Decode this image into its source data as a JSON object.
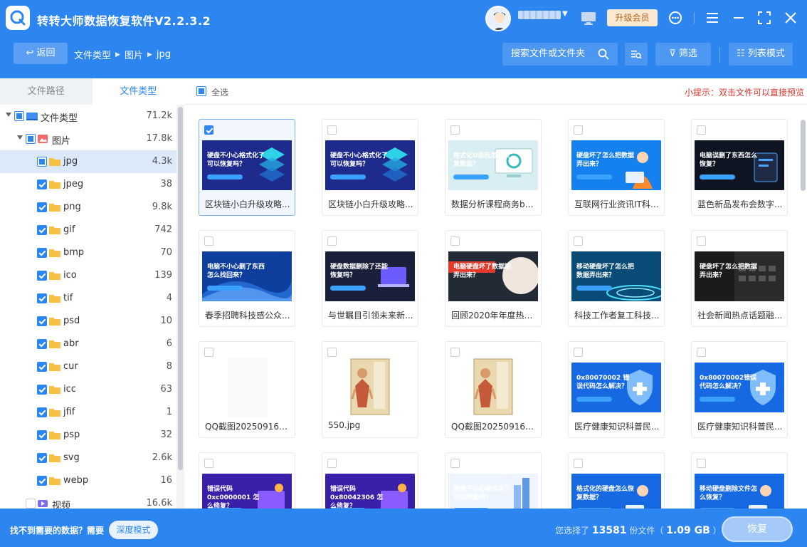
{
  "app": {
    "title": "转转大师数据恢复软件V2.2.3.2",
    "upgrade_label": "升级会员"
  },
  "toolbar": {
    "back_label": "返回",
    "breadcrumbs": [
      "文件类型",
      "图片",
      "jpg"
    ],
    "search_placeholder": "搜索文件或文件夹",
    "filter_label": "筛选",
    "view_label": "列表模式"
  },
  "left_tabs": [
    "文件路径",
    "文件类型"
  ],
  "tree": [
    {
      "label": "文件类型",
      "count": "71.2k",
      "state": "partial",
      "level": 0,
      "arrow": "down"
    },
    {
      "label": "图片",
      "count": "17.8k",
      "state": "partial",
      "level": 1,
      "arrow": "down"
    },
    {
      "label": "jpg",
      "count": "4.3k",
      "state": "partial",
      "level": 2,
      "selected": true
    },
    {
      "label": "jpeg",
      "count": "38",
      "state": "checked",
      "level": 2
    },
    {
      "label": "png",
      "count": "9.8k",
      "state": "checked",
      "level": 2
    },
    {
      "label": "gif",
      "count": "742",
      "state": "checked",
      "level": 2
    },
    {
      "label": "bmp",
      "count": "70",
      "state": "checked",
      "level": 2
    },
    {
      "label": "ico",
      "count": "139",
      "state": "checked",
      "level": 2
    },
    {
      "label": "tif",
      "count": "4",
      "state": "checked",
      "level": 2
    },
    {
      "label": "psd",
      "count": "10",
      "state": "checked",
      "level": 2
    },
    {
      "label": "abr",
      "count": "6",
      "state": "checked",
      "level": 2
    },
    {
      "label": "cur",
      "count": "8",
      "state": "checked",
      "level": 2
    },
    {
      "label": "icc",
      "count": "63",
      "state": "checked",
      "level": 2
    },
    {
      "label": "jfif",
      "count": "1",
      "state": "checked",
      "level": 2
    },
    {
      "label": "psp",
      "count": "32",
      "state": "checked",
      "level": 2
    },
    {
      "label": "svg",
      "count": "2.6k",
      "state": "checked",
      "level": 2
    },
    {
      "label": "webp",
      "count": "16",
      "state": "checked",
      "level": 2
    },
    {
      "label": "视频",
      "count": "16.6k",
      "state": "unchecked",
      "level": 1,
      "arrow": "right"
    }
  ],
  "main": {
    "select_all_label": "全选",
    "tip": "小提示：双击文件可以直接预览"
  },
  "files": [
    {
      "name": "区块链小白升级攻略...",
      "checked": true,
      "thumb": "硬盘不小心格式化了可以恢复吗？",
      "bg": "#1e2a8c",
      "style": "iso"
    },
    {
      "name": "区块链小白升级攻略...",
      "checked": false,
      "thumb": "硬盘不小心格式化了可以恢复吗？",
      "bg": "#1e2a8c",
      "style": "iso"
    },
    {
      "name": "数据分析课程商务ban...",
      "checked": false,
      "thumb": "格式化U盘后怎么恢复数据？",
      "bg": "#d9eef2",
      "style": "light"
    },
    {
      "name": "互联网行业资讯IT科技...",
      "checked": false,
      "thumb": "硬盘坏了怎么把数据弄出来？",
      "bg": "#1580f0",
      "style": "person"
    },
    {
      "name": "蓝色新品发布会数字...",
      "checked": false,
      "thumb": "电脑误删了东西怎么恢复？",
      "bg": "#0f1422",
      "style": "dark"
    },
    {
      "name": "春季招聘科技感公众...",
      "checked": false,
      "thumb": "电脑不小心删了东西怎么找回来？",
      "bg": "#0e3f9e",
      "style": "wave"
    },
    {
      "name": "与世瞩目引领未来新...",
      "checked": false,
      "thumb": "硬盘数据删除了还能恢复吗？",
      "bg": "#1a1f3a",
      "style": "laptop"
    },
    {
      "name": "回顾2020年年度热词...",
      "checked": false,
      "thumb": "电脑硬盘坏了数据能弄出来？",
      "bg": "#1d2430",
      "style": "red"
    },
    {
      "name": "科技工作者复工科技...",
      "checked": false,
      "thumb": "移动硬盘坏了怎么把数据弄出来？",
      "bg": "#0a4c78",
      "style": "teal"
    },
    {
      "name": "社会新闻热点话题融...",
      "checked": false,
      "thumb": "硬盘坏了怎么把数据弄出来？",
      "bg": "#1b1b1b",
      "style": "keyboard"
    },
    {
      "name": "QQ截图2025091617...",
      "checked": false,
      "thumb": "",
      "bg": "#ffffff",
      "style": "blank"
    },
    {
      "name": "550.jpg",
      "checked": false,
      "thumb": "",
      "bg": "#ffffff",
      "style": "book"
    },
    {
      "name": "QQ截图2025091616...",
      "checked": false,
      "thumb": "",
      "bg": "#ffffff",
      "style": "book"
    },
    {
      "name": "医疗健康知识科普民...",
      "checked": false,
      "thumb": "0x80070002 错误代码怎么解决？",
      "bg": "#1668e3",
      "style": "shield"
    },
    {
      "name": "医疗健康知识科普民...",
      "checked": false,
      "thumb": "0x80070002错误代码怎么解决？",
      "bg": "#1668e3",
      "style": "shield"
    },
    {
      "name": "",
      "checked": false,
      "thumb": "错误代码 0xc0000001 怎么修复？",
      "bg": "#3a1fa8",
      "style": "purple"
    },
    {
      "name": "",
      "checked": false,
      "thumb": "错误代码 0x80042306 怎么修复？",
      "bg": "#3a1fa8",
      "style": "purple"
    },
    {
      "name": "",
      "checked": false,
      "thumb": "硬盘不小心格式化了可以恢复吗？",
      "bg": "#eef5ff",
      "style": "lightblue"
    },
    {
      "name": "",
      "checked": false,
      "thumb": "格式化的硬盘怎么恢复数据？",
      "bg": "#1668e3",
      "style": "person"
    },
    {
      "name": "",
      "checked": false,
      "thumb": "移动硬盘删除文件怎么恢复？",
      "bg": "#1668e3",
      "style": "person"
    }
  ],
  "bottom": {
    "missing_text": "找不到需要的数据？需要",
    "deep_mode_label": "深度模式",
    "summary_prefix": "您选择了",
    "selected_count": "13581",
    "summary_mid": "份文件（",
    "selected_size": "1.09 GB",
    "summary_end": "）",
    "recover_label": "恢复"
  },
  "colors": {
    "brand": "#2d85f0",
    "tip_red": "#e0352b",
    "folder": "#f6c143"
  }
}
